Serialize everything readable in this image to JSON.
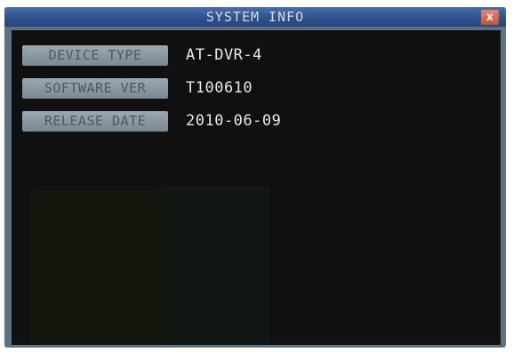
{
  "dialog": {
    "title": "SYSTEM INFO",
    "close_label": "x",
    "close_icon": "close-icon"
  },
  "info": {
    "rows": [
      {
        "label": "DEVICE TYPE",
        "value": "AT-DVR-4"
      },
      {
        "label": "SOFTWARE VER",
        "value": "T100610"
      },
      {
        "label": "RELEASE DATE",
        "value": "2010-06-09"
      }
    ]
  },
  "colors": {
    "title_bar": "#2e528e",
    "close_button": "#c4503c",
    "label_background": "#8c9aa5",
    "content_background": "#101010",
    "value_text": "#e8e8e8"
  }
}
